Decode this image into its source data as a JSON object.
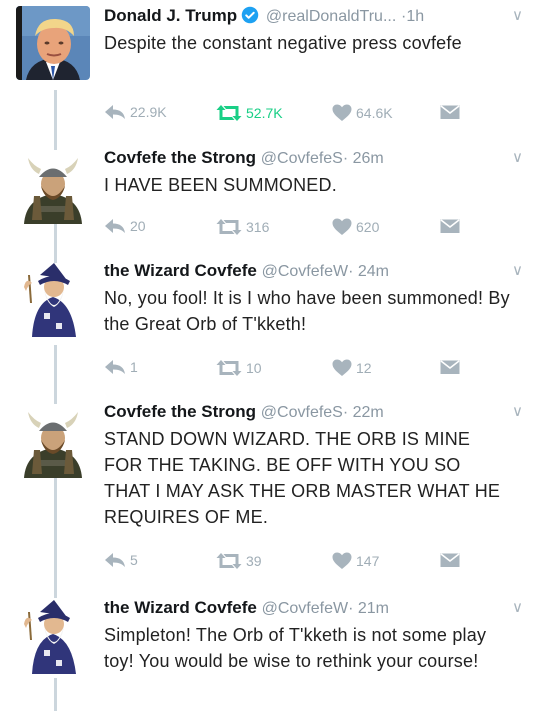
{
  "tweets": [
    {
      "avatar": "trump-photo",
      "name": "Donald J. Trump",
      "verified": true,
      "handle": "@realDonaldTru...",
      "time": "·1h",
      "text": "Despite the constant negative press covfefe",
      "replies": "22.9K",
      "retweets": "52.7K",
      "likes": "64.6K",
      "retweeted": true
    },
    {
      "avatar": "viking",
      "name": "Covfefe the Strong",
      "verified": false,
      "handle": "@CovfefeS",
      "time": "· 26m",
      "text": "I HAVE BEEN SUMMONED.",
      "replies": "20",
      "retweets": "316",
      "likes": "620",
      "retweeted": false
    },
    {
      "avatar": "wizard",
      "name": "the Wizard Covfefe",
      "verified": false,
      "handle": "@CovfefeW",
      "time": "· 24m",
      "text": "No, you fool! It is I who have been summoned! By the Great Orb of T'kketh!",
      "replies": "1",
      "retweets": "10",
      "likes": "12",
      "retweeted": false
    },
    {
      "avatar": "viking",
      "name": "Covfefe the Strong",
      "verified": false,
      "handle": "@CovfefeS",
      "time": "· 22m",
      "text": "STAND DOWN WIZARD. THE ORB IS MINE FOR THE TAKING. BE OFF WITH YOU SO THAT I MAY ASK THE ORB MASTER WHAT HE REQUIRES OF ME.",
      "replies": "5",
      "retweets": "39",
      "likes": "147",
      "retweeted": false
    },
    {
      "avatar": "wizard",
      "name": "the Wizard Covfefe",
      "verified": false,
      "handle": "@CovfefeW",
      "time": "· 21m",
      "text": "Simpleton! The Orb of T'kketh is not some play toy! You would be wise to rethink your course!",
      "replies": "",
      "retweets": "",
      "likes": "",
      "retweeted": false
    }
  ],
  "colors": {
    "text": "#1c2022",
    "muted": "#8a97a2",
    "icon": "#a8b4bd",
    "retweet_active": "#19cf86",
    "verified": "#1da1f2",
    "thread_line": "#ccd6dd"
  }
}
